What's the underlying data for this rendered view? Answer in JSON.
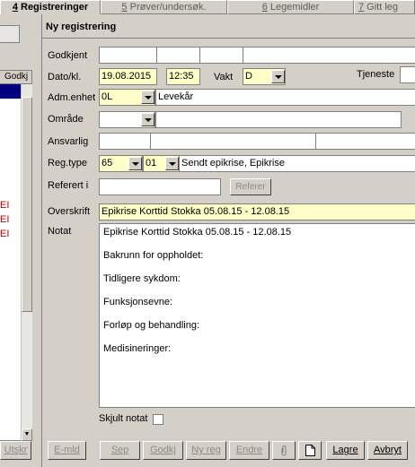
{
  "tabs": [
    {
      "key": "4",
      "label": " Registreringer"
    },
    {
      "key": "5",
      "label": " Prøver/undersøk."
    },
    {
      "key": "6",
      "label": " Legemidler"
    },
    {
      "key": "7",
      "label": " Gitt leg"
    }
  ],
  "left_list": {
    "header": "Godkj",
    "red_items": [
      "EI",
      "EI",
      "EI"
    ]
  },
  "form": {
    "title": "Ny registrering",
    "labels": {
      "godkjent": "Godkjent",
      "dato": "Dato/kl.",
      "vakt": "Vakt",
      "tjeneste": "Tjeneste",
      "adm_enhet": "Adm.enhet",
      "omrade": "Område",
      "ansvarlig": "Ansvarlig",
      "reg_type": "Reg.type",
      "referert_i": "Referert i",
      "overskrift": "Overskrift",
      "notat": "Notat",
      "skjult_notat": "Skjult notat"
    },
    "values": {
      "dato": "19.08.2015",
      "klokke": "12:35",
      "vakt": "D",
      "adm_enhet_code": "0L",
      "adm_enhet_name": "Levekår",
      "reg_type_code": "65",
      "reg_type_sub": "01",
      "reg_type_name": "Sendt epikrise, Epikrise",
      "overskrift": "Epikrise Korttid Stokka 05.08.15 - 12.08.15"
    },
    "refer_button": "Referer",
    "notat_lines": [
      "Epikrise Korttid Stokka 05.08.15 - 12.08.15",
      "",
      "Bakrunn for oppholdet:",
      "",
      "Tidligere sykdom:",
      "",
      "Funksjonsevne:",
      "",
      "Forløp og behandling:",
      "",
      "Medisineringer:"
    ]
  },
  "buttons": {
    "utskr": "Utskr",
    "emld": "E-mld",
    "sep": "Sep",
    "godkj": "Godkj",
    "nyreg": "Ny reg",
    "endre": "Endre",
    "lagre": "Lagre",
    "avbryt": "Avbryt"
  }
}
